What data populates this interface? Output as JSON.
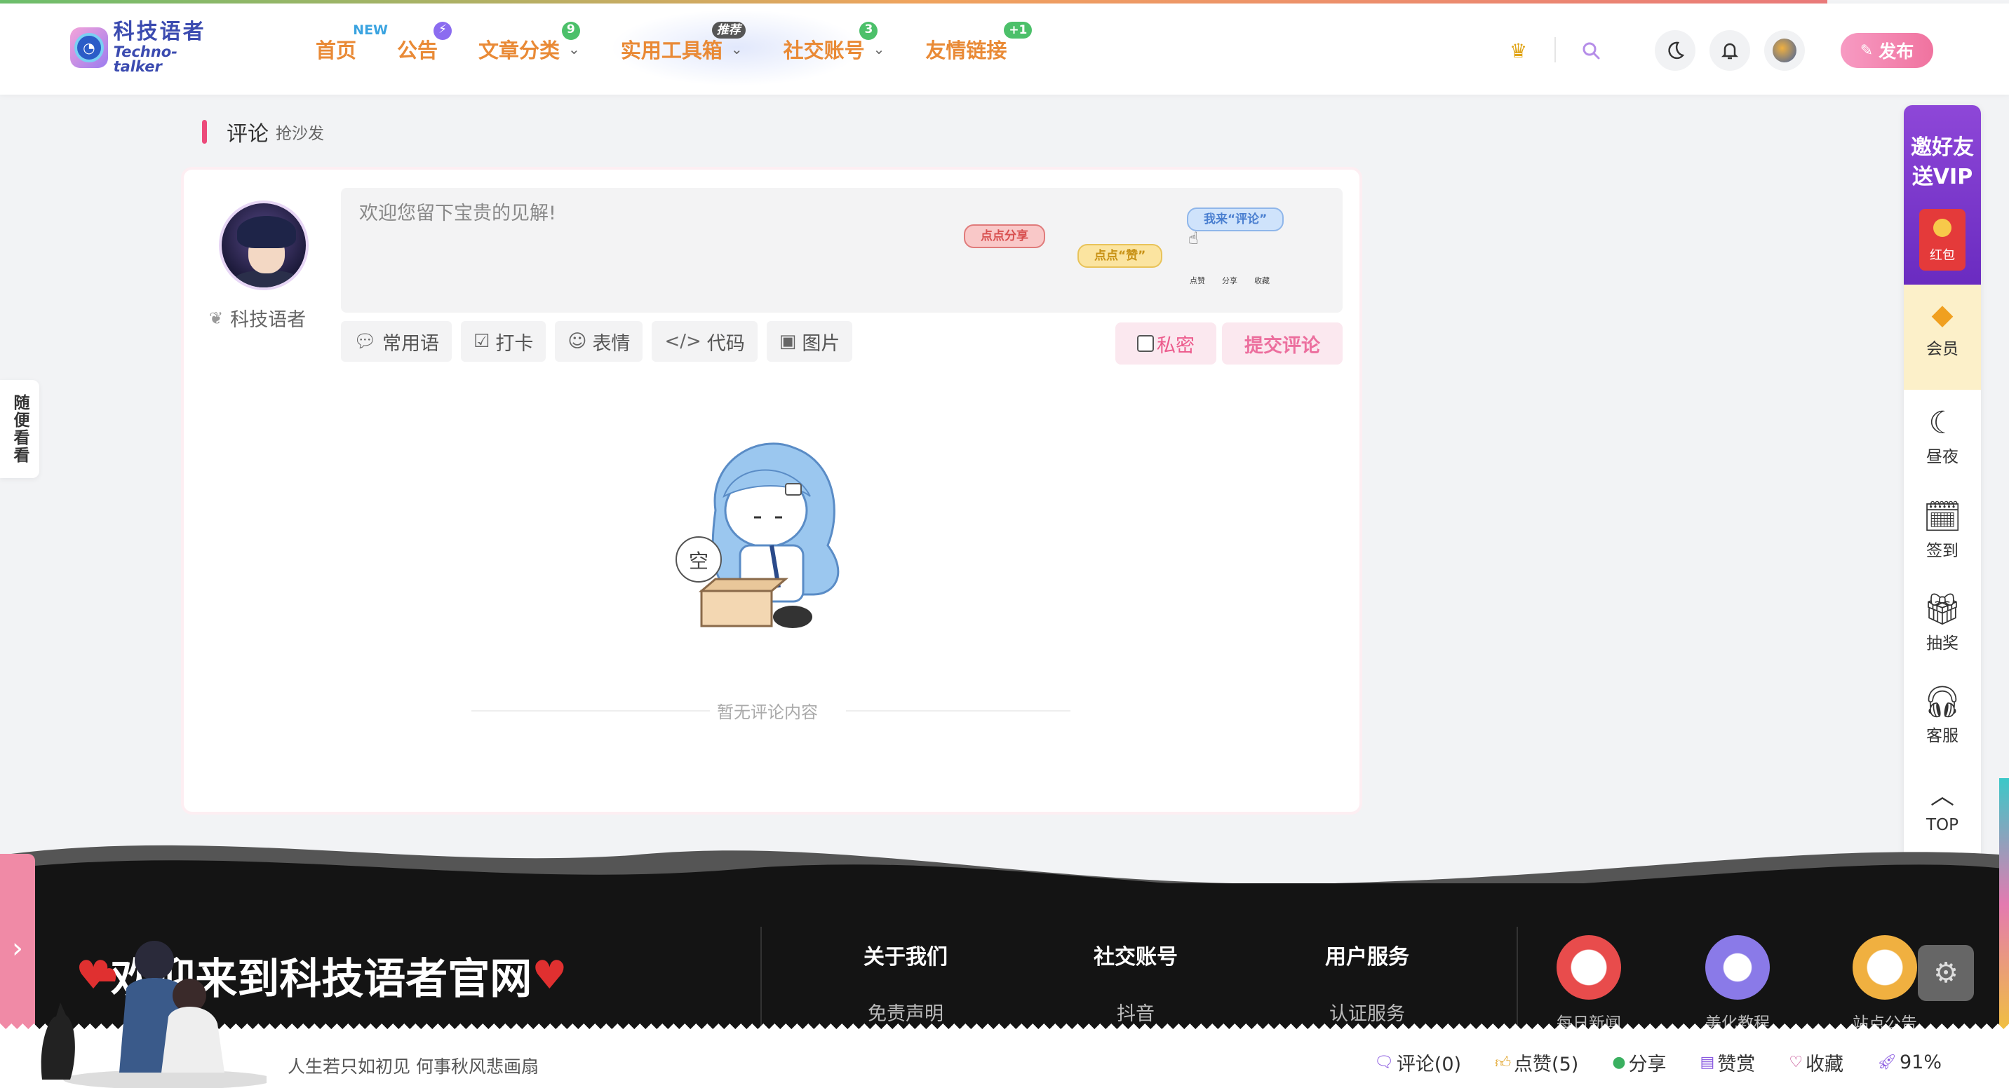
{
  "header": {
    "logo_cn": "科技语者",
    "logo_en": "Techno-talker",
    "nav": [
      {
        "label": "首页",
        "badge": "NEW"
      },
      {
        "label": "公告",
        "badge": "⚡"
      },
      {
        "label": "文章分类",
        "badge": "9"
      },
      {
        "label": "实用工具箱",
        "badge": "推荐"
      },
      {
        "label": "社交账号",
        "badge": "3"
      },
      {
        "label": "友情链接",
        "badge": "+1"
      }
    ],
    "publish_label": "发布"
  },
  "comments": {
    "title": "评论",
    "subtitle": "抢沙发",
    "user_name": "科技语者",
    "placeholder": "欢迎您留下宝贵的见解!",
    "promo_tags": {
      "share": "点点分享",
      "like": "点点“赞”",
      "comment": "我来“评论”"
    },
    "promo_tiny": [
      "点赞",
      "分享",
      "收藏"
    ],
    "tools": [
      "常用语",
      "打卡",
      "表情",
      "代码",
      "图片"
    ],
    "private_label": "私密",
    "submit_label": "提交评论",
    "empty_bubble": "空",
    "empty_text": "暂无评论内容"
  },
  "right_panel": {
    "vip_text": "邀好友送VIP",
    "envelope_label": "红包",
    "member_label": "会员",
    "items": [
      "昼夜",
      "签到",
      "抽奖",
      "客服",
      "TOP"
    ]
  },
  "left_float_label": "随便看看",
  "footer": {
    "welcome": "欢迎来到科技语者官网",
    "columns": [
      {
        "heading": "关于我们",
        "item": "免责声明"
      },
      {
        "heading": "社交账号",
        "item": "抖音"
      },
      {
        "heading": "用户服务",
        "item": "认证服务"
      }
    ],
    "apps": [
      "每日新闻",
      "美化教程",
      "站点公告"
    ]
  },
  "bottom_bar": {
    "motto": "人生若只如初见 何事秋风悲画扇",
    "comment": "评论(0)",
    "like": "点赞(5)",
    "share": "分享",
    "reward": "赞赏",
    "favorite": "收藏",
    "progress": "91%"
  },
  "colors": {
    "accent": "#ec4a7a",
    "nav_text": "#e98a36",
    "vip": "#8e47d8",
    "footer_bg": "#141414"
  }
}
